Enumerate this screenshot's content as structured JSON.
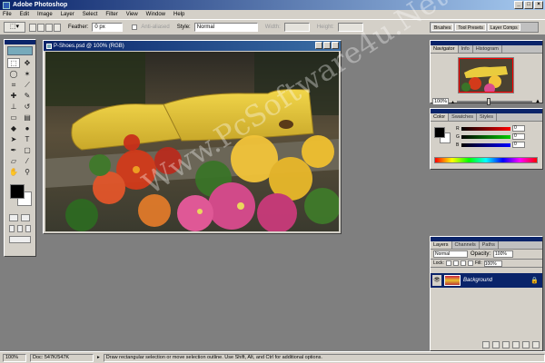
{
  "app": {
    "title": "Adobe Photoshop"
  },
  "menu": [
    "File",
    "Edit",
    "Image",
    "Layer",
    "Select",
    "Filter",
    "View",
    "Window",
    "Help"
  ],
  "options": {
    "feather_label": "Feather:",
    "feather_value": "0 px",
    "antialiased_label": "Anti-aliased",
    "style_label": "Style:",
    "style_value": "Normal",
    "width_label": "Width:",
    "height_label": "Height:"
  },
  "palette_well": [
    "Brushes",
    "Tool Presets",
    "Layer Comps"
  ],
  "document": {
    "title": "P-Shoes.psd @ 100% (RGB)"
  },
  "navigator": {
    "tabs": [
      "Navigator",
      "Info",
      "Histogram"
    ],
    "zoom": "100%",
    "zoom_slider": 0.4
  },
  "color": {
    "tabs": [
      "Color",
      "Swatches",
      "Styles"
    ],
    "channels": [
      {
        "label": "R",
        "value": "0"
      },
      {
        "label": "G",
        "value": "0"
      },
      {
        "label": "B",
        "value": "0"
      }
    ]
  },
  "layers": {
    "tabs": [
      "Layers",
      "Channels",
      "Paths"
    ],
    "blend_mode": "Normal",
    "opacity_label": "Opacity:",
    "opacity_value": "100%",
    "lock_label": "Lock:",
    "fill_label": "Fill:",
    "fill_value": "100%",
    "layer_name": "Background"
  },
  "status": {
    "zoom": "100%",
    "doc_size": "Doc: 547K/547K",
    "message": "Draw rectangular selection or move selection outline. Use Shift, Alt, and Ctrl for additional options."
  },
  "watermark": "Www.PcSoftware4u.Net",
  "colors": {
    "title_bar": "#0a246a",
    "chrome": "#d4d0c8",
    "workspace": "#7f7f7f"
  }
}
